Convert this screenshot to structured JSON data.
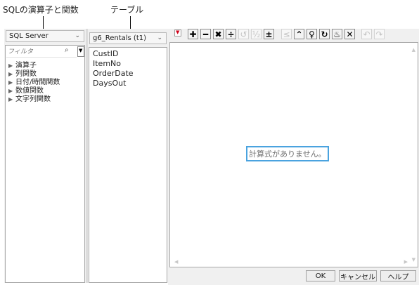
{
  "callouts": {
    "functions_label": "SQLの演算子と関数",
    "table_label": "テーブル"
  },
  "left_panel": {
    "dialect_select": "SQL Server",
    "filter_placeholder": "フィルタ",
    "tree_items": [
      "演算子",
      "列関数",
      "日付/時間関数",
      "数値関数",
      "文字列関数"
    ]
  },
  "middle_panel": {
    "table_select": "g6_Rentals (t1)",
    "columns": [
      "CustID",
      "ItemNo",
      "OrderDate",
      "DaysOut"
    ]
  },
  "toolbar": {
    "dropdown_icon": "red-down-triangle",
    "buttons": [
      {
        "icon": "plus-icon",
        "glyph": "✚",
        "enabled": true
      },
      {
        "icon": "minus-icon",
        "glyph": "━",
        "enabled": true
      },
      {
        "icon": "multiply-icon",
        "glyph": "✖",
        "enabled": true
      },
      {
        "icon": "divide-icon",
        "glyph": "÷",
        "enabled": true
      },
      {
        "icon": "undo-small-icon",
        "glyph": "↺",
        "enabled": false
      },
      {
        "icon": "fraction-icon",
        "glyph": "½",
        "enabled": false
      },
      {
        "icon": "plus-minus-icon",
        "glyph": "±",
        "enabled": true
      },
      {
        "icon": "less-equal-icon",
        "glyph": "≤",
        "enabled": false
      },
      {
        "icon": "caret-up-icon",
        "glyph": "⌃",
        "enabled": true
      },
      {
        "icon": "swap-icon",
        "glyph": "♀",
        "enabled": true
      },
      {
        "icon": "refresh-icon",
        "glyph": "↻",
        "enabled": true
      },
      {
        "icon": "gear-icon",
        "glyph": "♨",
        "enabled": true
      },
      {
        "icon": "clear-icon",
        "glyph": "✕",
        "enabled": true
      },
      {
        "icon": "undo-icon",
        "glyph": "↶",
        "enabled": false
      },
      {
        "icon": "redo-icon",
        "glyph": "↷",
        "enabled": false
      }
    ]
  },
  "editor": {
    "empty_message": "計算式がありません。"
  },
  "buttons": {
    "ok": "OK",
    "cancel": "キャンセル",
    "help": "ヘルプ"
  }
}
